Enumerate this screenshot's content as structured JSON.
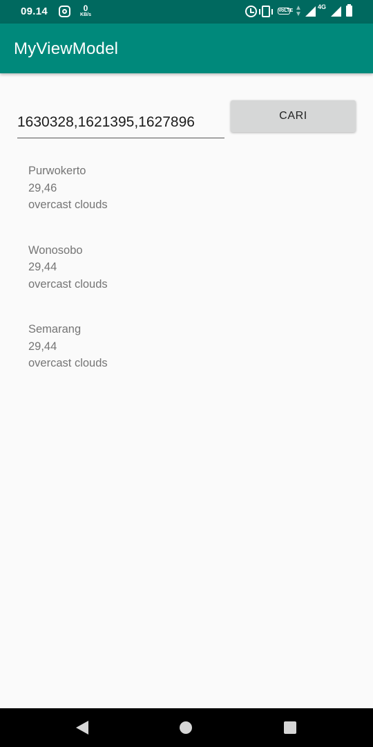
{
  "status_bar": {
    "time": "09.14",
    "net_speed_value": "0",
    "net_speed_unit": "KB/s",
    "volte_label": "VoLTE",
    "network_type": "4G",
    "icons": [
      "instagram-icon",
      "alarm-icon",
      "vibrate-icon",
      "volte-icon",
      "data-arrows-icon",
      "signal-icon",
      "battery-icon"
    ]
  },
  "app_bar": {
    "title": "MyViewModel",
    "color": "#00897b"
  },
  "search": {
    "value": "1630328,1621395,1627896",
    "button_label": "CARI"
  },
  "weather_list": [
    {
      "city": "Purwokerto",
      "temperature": "29,46",
      "description": "overcast clouds"
    },
    {
      "city": "Wonosobo",
      "temperature": "29,44",
      "description": "overcast clouds"
    },
    {
      "city": "Semarang",
      "temperature": "29,44",
      "description": "overcast clouds"
    }
  ],
  "nav_bar": {
    "icons": [
      "back-icon",
      "home-icon",
      "recents-icon"
    ]
  },
  "colors": {
    "status_bar": "#00695f",
    "primary": "#00897b",
    "background": "#fafafa",
    "button": "#d6d7d7"
  }
}
